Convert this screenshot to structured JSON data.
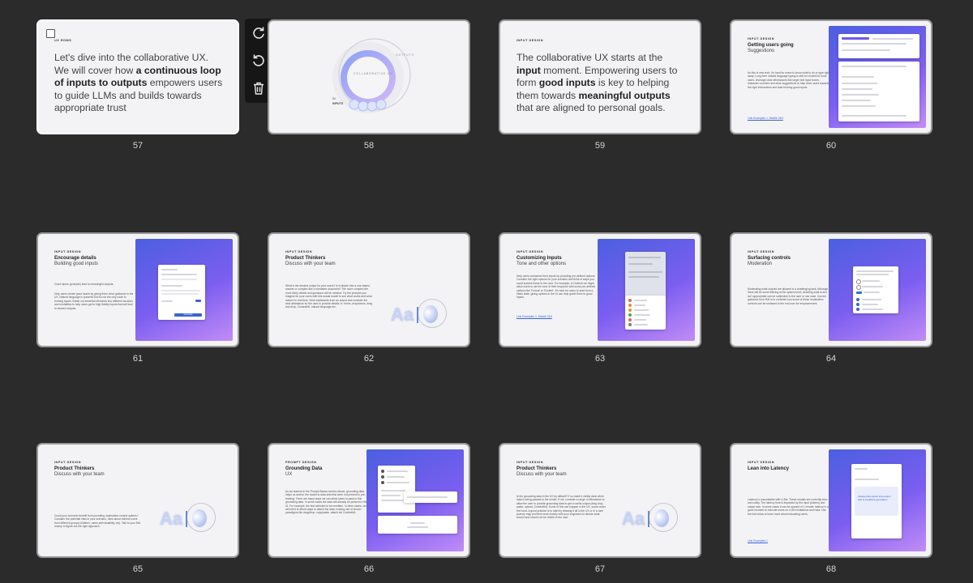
{
  "toolbar": {
    "redo_icon": "redo-icon",
    "undo_icon": "undo-icon",
    "delete_icon": "trash-icon"
  },
  "slides": [
    {
      "number": "57",
      "tag": "UX ROMS"
    },
    {
      "number": "58",
      "orbit_label": "COLLABORATIVE UX",
      "outputs_label": "OUTPUTS",
      "inputs_label": "INPUTS",
      "in_label": "IN"
    },
    {
      "number": "59",
      "tag": "INPUT DESIGN"
    },
    {
      "number": "60",
      "tag": "INPUT DESIGN",
      "title": "Getting users going",
      "subtitle": "Suggestions",
      "body": "As this is new tech, it's hard for users to know what to do or type right away. Long form natural language typing is still not a habit for most users, leverage clear affordances like larger text input boxes, character counters and clear suggestions to help drive users towards the right interactions and start forming good inputs.",
      "link": "Link Examples 1, Mobile 2&3"
    },
    {
      "number": "61",
      "tag": "INPUT DESIGN",
      "title": "Encourage details",
      "subtitle": "Building good inputs",
      "body1": "Good inputs (prompts) lead to meaningful outputs.",
      "body2": "Help users create good inputs by giving them clear guidance in the UX. Natural language is powerful but it's not the only route to forming inputs. Break out essential elements into different sections and modalities to help users get to high fidelity inputs that will lead to desired outputs.",
      "button": "Generate"
    },
    {
      "number": "62",
      "tag": "INPUT DESIGN",
      "title": "Product Thinkers",
      "subtitle": "Discuss with your team",
      "body": "What is the desired output for your users? Is it simple, like a one-based answer or complex like a formatted document? The more complex the more likely details and guidance will be needed. Try the prompts you imagine for your users with this actual model to see what works and what doesn't in real time. Work backwards from an output and consider the best affordance for the user to provide details i.e. forms, dropdowns, drag and drop, ContextKit, natural language etc."
    },
    {
      "number": "63",
      "tag": "INPUT DESIGN",
      "title": "Customizing Inputs",
      "subtitle": "Tone and other options",
      "body": "Help users customize their inputs by providing pre-defined options. Consider the right options for your scenario and think of ways you could surface these to the user. For example, in Outlook we might allow users to set the tone of their response with some pre-defined options like 'Formal' or 'Excited'. It's hard for users to start from a blank slate, giving options in the UI can help guide them to good inputs.",
      "link": "Link Examples 1, Mobile 2&3"
    },
    {
      "number": "64",
      "tag": "INPUT DESIGN",
      "title": "Surfacing controls",
      "subtitle": "Moderation",
      "body": "Moderating what outputs are allowed is a challenging task. Although there will be some filtering at the system level, deciding what is and isn't appropriate can be subjective to the user or use case. Current guidance from RAI is to consider how some of these moderation controls can be surfaced to the end user for empowerment."
    },
    {
      "number": "65",
      "tag": "INPUT DESIGN",
      "title": "Product Thinkers",
      "subtitle": "Discuss with your team",
      "body": "Could your scenario benefit from providing moderation control options? Consider the potential risks in your scenario, think about indirect users from different groups (children, users with disability, etc). Talk to your RAI champ to figure out the right approach."
    },
    {
      "number": "66",
      "tag": "PROMPT DESIGN",
      "title": "Grounding Data",
      "subtitle": "UX",
      "body": "As we learned in the Prompt Basics section above, grounding data helps us anchor the model to data sets that were not present in pre-training. There are many ways we can allow users to pass in this grounding data. In some cases the data will already be present in the UI. For example, the text selected to be rewritten. In other cases, we will need to afford ways to attach the data, making use of known paradigms like drag/drop, copy/paste, attach etc ContextKit."
    },
    {
      "number": "67",
      "tag": "INPUT DESIGN",
      "title": "Product Thinkers",
      "subtitle": "Discuss with your team",
      "body": "Is the grounding data in the UX by default? If so make it visibly clear when data is being passed to the model. If not, consider a range of affordance to allow the user to provide grounding data to get a useful output (drag drop, paste, upload, ContextKit). Some of this can happen in the UX, some under the hood. A good practice is to start by drawing it all in the UX or in a user journey map and then work closely with your engineers to decide what should and should not be visible to the user."
    },
    {
      "number": "68",
      "tag": "INPUT DESIGN",
      "title": "Lean into Latency",
      "body": "Latency is unavoidable with LLMs. These models are currently slow and costly. The latency time is impacted by the input (tokens) and output size. In some cases it can be upward of 1 minute, latency is a good moment to educate users on LLM's limitations and risks. Use the link below to learn more about educating users.",
      "link": "Link Examples 1",
      "card_text": "Always think about information that to feedback generation"
    }
  ],
  "slide57": {
    "text_pre": "Let's dive into the collaborative UX. We will cover how ",
    "text_bold": "a continuous loop of inputs to outputs",
    "text_post": " empowers users to guide LLMs and builds towards appropriate trust"
  },
  "slide59": {
    "t1": "The collaborative UX starts at the ",
    "b1": "input",
    "t2": " moment. Empowering users to form ",
    "b2": "good inputs",
    "t3": " is key to helping them towards ",
    "b3": "meaningful outputs",
    "t4": " that are aligned to personal goals."
  },
  "aa_label": "Aa",
  "colors": {
    "background": "#2b2b2b",
    "slide": "#f3f3f5",
    "accent": "#6d5be8",
    "gradient_start": "#4b5fe0",
    "gradient_end": "#c18cf7"
  }
}
